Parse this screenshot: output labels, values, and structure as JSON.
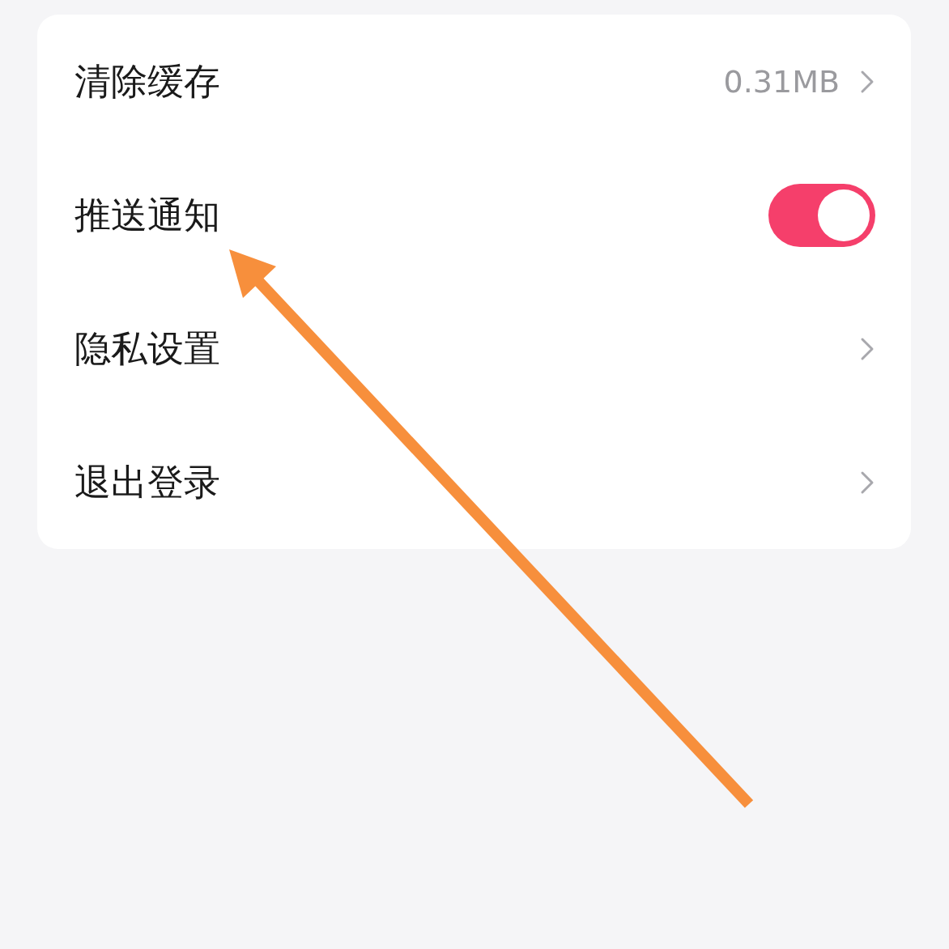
{
  "settings": [
    {
      "kind": "value",
      "label": "清除缓存",
      "value": "0.31MB"
    },
    {
      "kind": "toggle",
      "label": "推送通知",
      "on": true
    },
    {
      "kind": "link",
      "label": "隐私设置"
    },
    {
      "kind": "link",
      "label": "退出登录"
    }
  ]
}
